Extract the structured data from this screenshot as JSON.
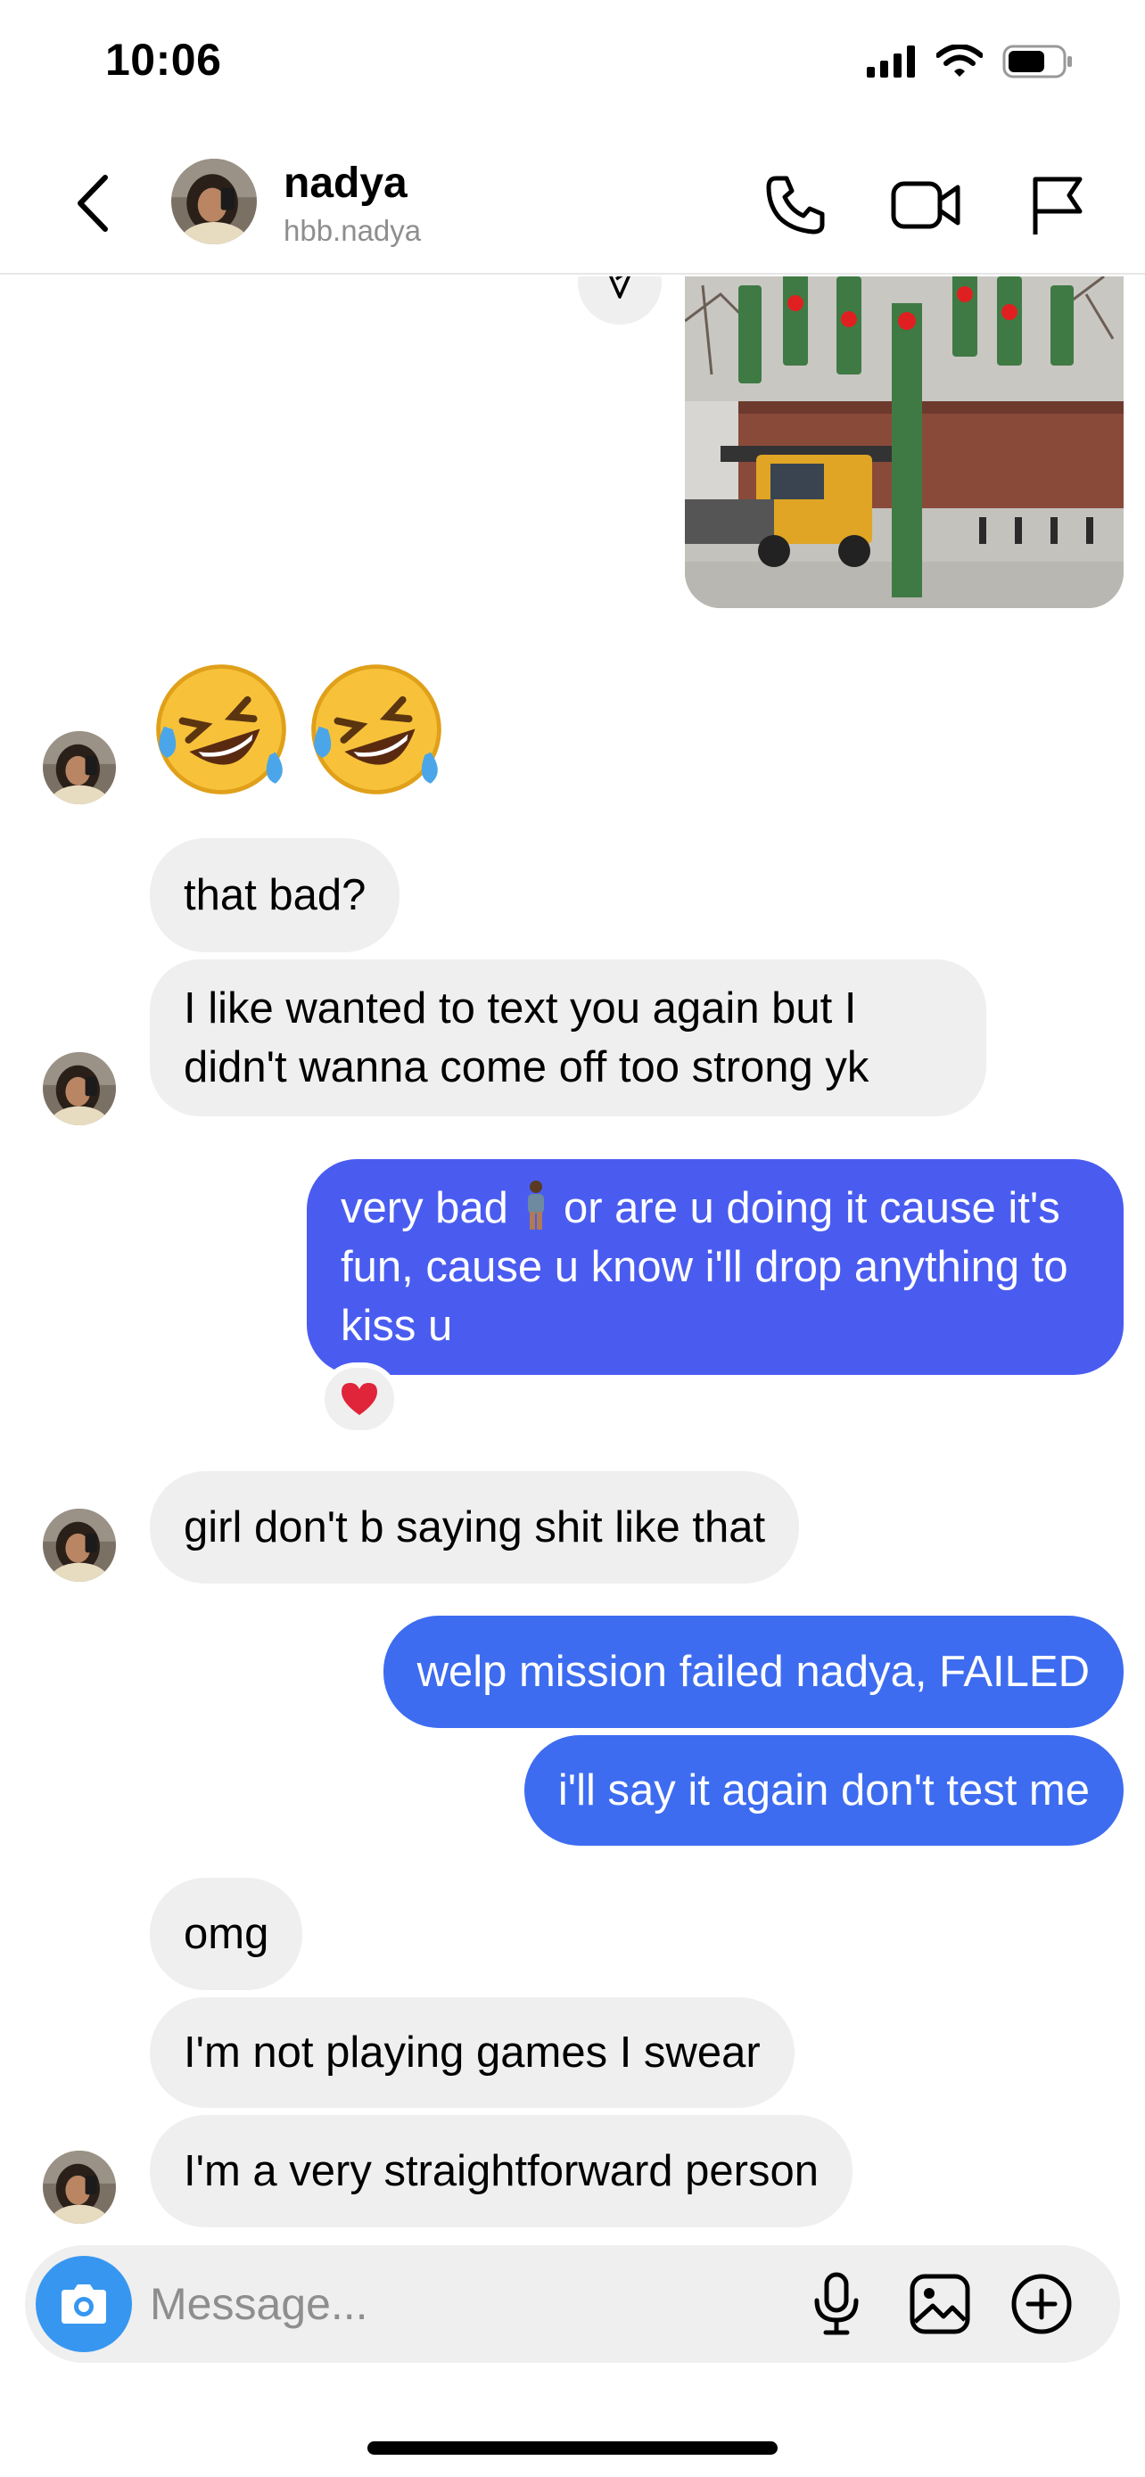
{
  "status_bar": {
    "time": "10:06",
    "icons": [
      "signal-icon",
      "wifi-icon",
      "battery-icon"
    ]
  },
  "header": {
    "name": "nadya",
    "handle": "hbb.nadya",
    "icons": [
      "back-icon",
      "phone-icon",
      "video-icon",
      "flag-icon"
    ]
  },
  "colors": {
    "outgoing_purple": "#4a5cf0",
    "outgoing_blue": "#3d6cf0",
    "incoming_gray": "#efefef",
    "camera_blue": "#3797f0"
  },
  "messages": {
    "emoji_reply": "🤣🤣",
    "m1": "that bad?",
    "m2": "I like wanted to text you again but I didn't wanna come off too strong yk",
    "m3_before": "very bad",
    "m3_after": "or are u doing it cause it's fun, cause u know i'll drop anything to kiss u",
    "m3_reaction": "heart-reaction",
    "m4": "girl don't b saying shit like that",
    "m5": "welp mission failed nadya, FAILED",
    "m6": "i'll say it again don't test me",
    "m7": "omg",
    "m8": "I'm not playing games I swear",
    "m9": "I'm a very straightforward person"
  },
  "composer": {
    "placeholder": "Message...",
    "icons": [
      "camera-icon",
      "microphone-icon",
      "gallery-icon",
      "add-icon"
    ]
  }
}
